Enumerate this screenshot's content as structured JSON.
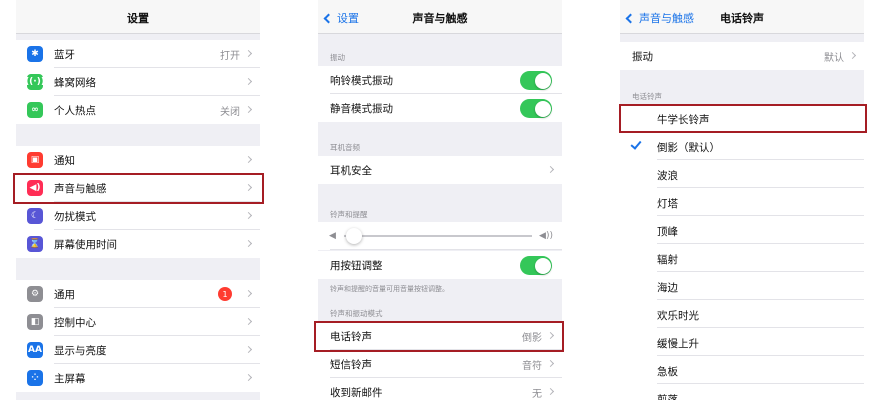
{
  "panel1": {
    "title": "设置",
    "groups": [
      [
        {
          "label": "蓝牙",
          "value": "打开",
          "icon": "bluetooth-icon",
          "glyph": "✱",
          "color": "#1a73e8"
        },
        {
          "label": "蜂窝网络",
          "value": "",
          "icon": "cellular-icon",
          "glyph": "((·))",
          "color": "#34c759"
        },
        {
          "label": "个人热点",
          "value": "关闭",
          "icon": "hotspot-icon",
          "glyph": "∞",
          "color": "#34c759"
        }
      ],
      [
        {
          "label": "通知",
          "value": "",
          "icon": "notifications-icon",
          "glyph": "▣",
          "color": "#ff3b30"
        },
        {
          "label": "声音与触感",
          "value": "",
          "icon": "sound-icon",
          "glyph": "◀)",
          "color": "#ff2d55"
        },
        {
          "label": "勿扰模式",
          "value": "",
          "icon": "do-not-disturb-icon",
          "glyph": "☾",
          "color": "#5856d6"
        },
        {
          "label": "屏幕使用时间",
          "value": "",
          "icon": "screen-time-icon",
          "glyph": "⌛",
          "color": "#5856d6"
        }
      ],
      [
        {
          "label": "通用",
          "value": "",
          "icon": "general-icon",
          "glyph": "⚙",
          "color": "#8e8e93",
          "badge": "1"
        },
        {
          "label": "控制中心",
          "value": "",
          "icon": "control-center-icon",
          "glyph": "◧",
          "color": "#8e8e93"
        },
        {
          "label": "显示与亮度",
          "value": "",
          "icon": "display-icon",
          "glyph": "AA",
          "color": "#1a73e8"
        },
        {
          "label": "主屏幕",
          "value": "",
          "icon": "home-screen-icon",
          "glyph": "⁘",
          "color": "#1a73e8"
        }
      ]
    ]
  },
  "panel2": {
    "back": "设置",
    "title": "声音与触感",
    "section_vibrate": "振动",
    "ring_vibrate": "响铃模式振动",
    "silent_vibrate": "静音模式振动",
    "section_headphone": "耳机音频",
    "headphone_safety": "耳机安全",
    "section_ringer": "铃声和提醒",
    "volume_low_icon": "◀",
    "volume_high_icon": "◀))",
    "change_with_buttons": "用按钮调整",
    "note": "铃声和提醒的音量可用音量按钮调整。",
    "section_patterns": "铃声和振动模式",
    "ringtone_label": "电话铃声",
    "ringtone_value": "倒影",
    "text_tone_label": "短信铃声",
    "text_tone_value": "音符",
    "new_mail_label": "收到新邮件",
    "new_mail_value": "无"
  },
  "panel3": {
    "back": "声音与触感",
    "title": "电话铃声",
    "vibration_label": "振动",
    "vibration_value": "默认",
    "section_ringtones": "电话铃声",
    "tones": [
      "牛学长铃声",
      "倒影（默认）",
      "波浪",
      "灯塔",
      "顶峰",
      "辐射",
      "海边",
      "欢乐时光",
      "缓慢上升",
      "急板",
      "剪落"
    ],
    "selected_index": 1
  },
  "colors": {
    "accent": "#1a73e8",
    "toggle_on": "#34c759",
    "highlight": "#a51d24",
    "badge": "#ff3b30"
  }
}
